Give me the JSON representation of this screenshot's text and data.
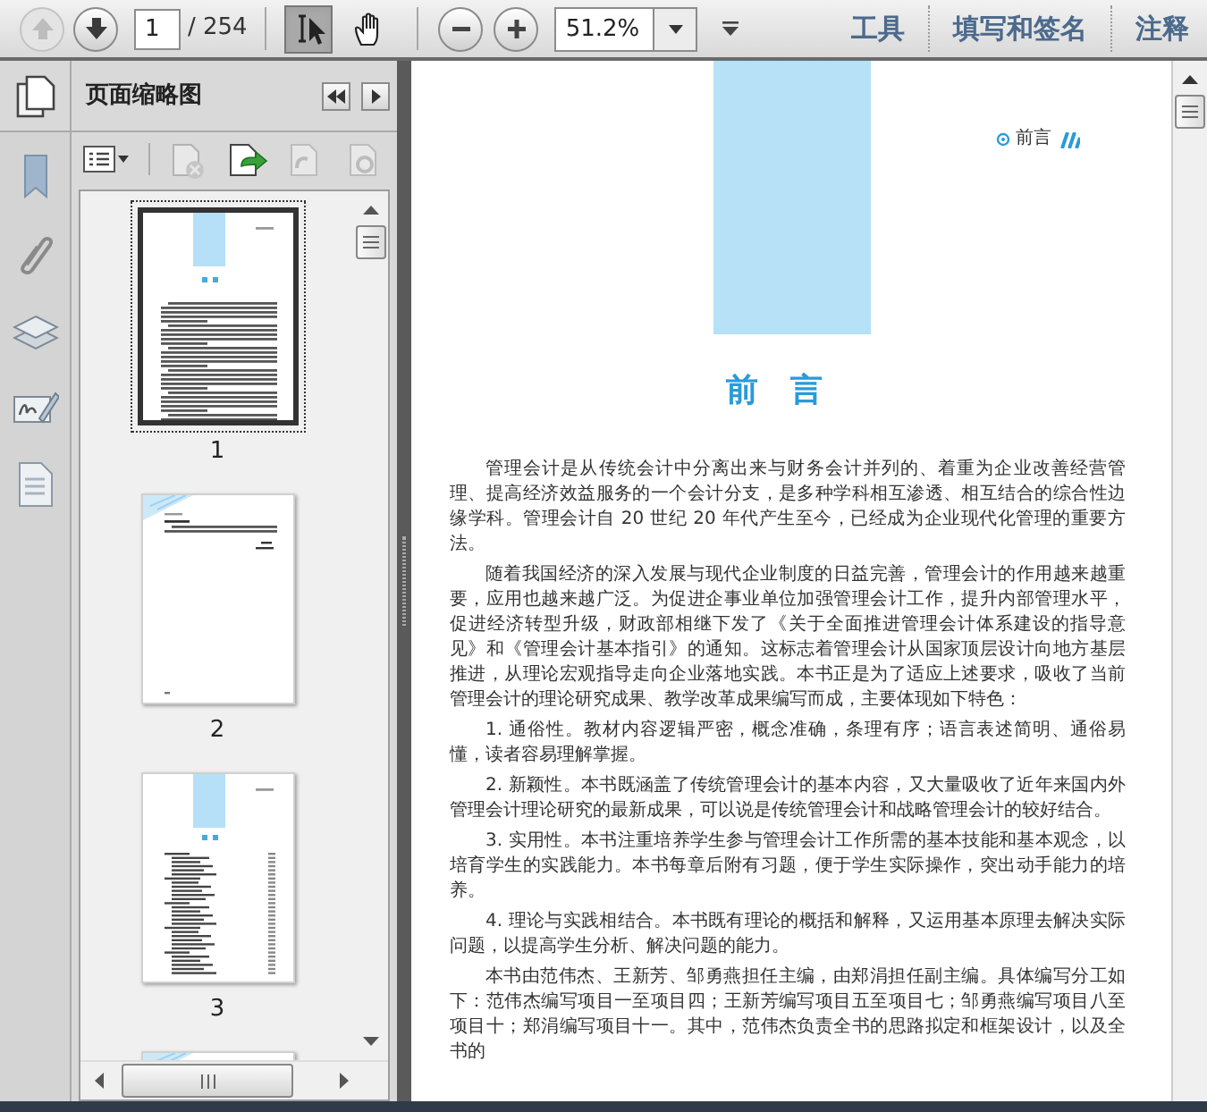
{
  "toolbar": {
    "nav": [
      {
        "kind": "prev",
        "disabled": true
      },
      {
        "kind": "next",
        "disabled": false
      }
    ],
    "page_number": "1",
    "page_count": "/ 254",
    "tools": [
      {
        "kind": "select",
        "selected": true
      },
      {
        "kind": "hand",
        "selected": false
      }
    ],
    "zoom": "51.2%",
    "panes": [
      "工具",
      "填写和签名",
      "注释"
    ]
  },
  "sidebar": {
    "title": "页面缩略图",
    "panel_tools": [
      {
        "kind": "options",
        "disabled": false
      },
      {
        "kind": "delete",
        "disabled": true
      },
      {
        "kind": "insert",
        "disabled": false
      },
      {
        "kind": "undo",
        "disabled": true
      },
      {
        "kind": "redo",
        "disabled": true
      }
    ],
    "thumbnails": [
      {
        "label": "1",
        "kind": "preface",
        "selected": true
      },
      {
        "label": "2",
        "kind": "note",
        "selected": false
      },
      {
        "label": "3",
        "kind": "contents",
        "selected": false
      },
      {
        "kind": "note",
        "selected": false
      }
    ]
  },
  "document": {
    "running_head": "前言",
    "title": "前 言",
    "paragraphs": [
      "管理会计是从传统会计中分离出来与财务会计并列的、着重为企业改善经营管理、提高经济效益服务的一个会计分支，是多种学科相互渗透、相互结合的综合性边缘学科。管理会计自 20 世纪 20 年代产生至今，已经成为企业现代化管理的重要方法。",
      "随着我国经济的深入发展与现代企业制度的日益完善，管理会计的作用越来越重要，应用也越来越广泛。为促进企事业单位加强管理会计工作，提升内部管理水平，促进经济转型升级，财政部相继下发了《关于全面推进管理会计体系建设的指导意见》和《管理会计基本指引》的通知。这标志着管理会计从国家顶层设计向地方基层推进，从理论宏观指导走向企业落地实践。本书正是为了适应上述要求，吸收了当前管理会计的理论研究成果、教学改革成果编写而成，主要体现如下特色：",
      "1. 通俗性。教材内容逻辑严密，概念准确，条理有序；语言表述简明、通俗易懂，读者容易理解掌握。",
      "2. 新颖性。本书既涵盖了传统管理会计的基本内容，又大量吸收了近年来国内外管理会计理论研究的最新成果，可以说是传统管理会计和战略管理会计的较好结合。",
      "3. 实用性。本书注重培养学生参与管理会计工作所需的基本技能和基本观念，以培育学生的实践能力。本书每章后附有习题，便于学生实际操作，突出动手能力的培养。",
      "4. 理论与实践相结合。本书既有理论的概括和解释，又运用基本原理去解决实际问题，以提高学生分析、解决问题的能力。",
      "本书由范伟杰、王新芳、邹勇燕担任主编，由郑涓担任副主编。具体编写分工如下：范伟杰编写项目一至项目四；王新芳编写项目五至项目七；邹勇燕编写项目八至项目十；郑涓编写项目十一。其中，范伟杰负责全书的思路拟定和框架设计，以及全书的"
    ]
  }
}
